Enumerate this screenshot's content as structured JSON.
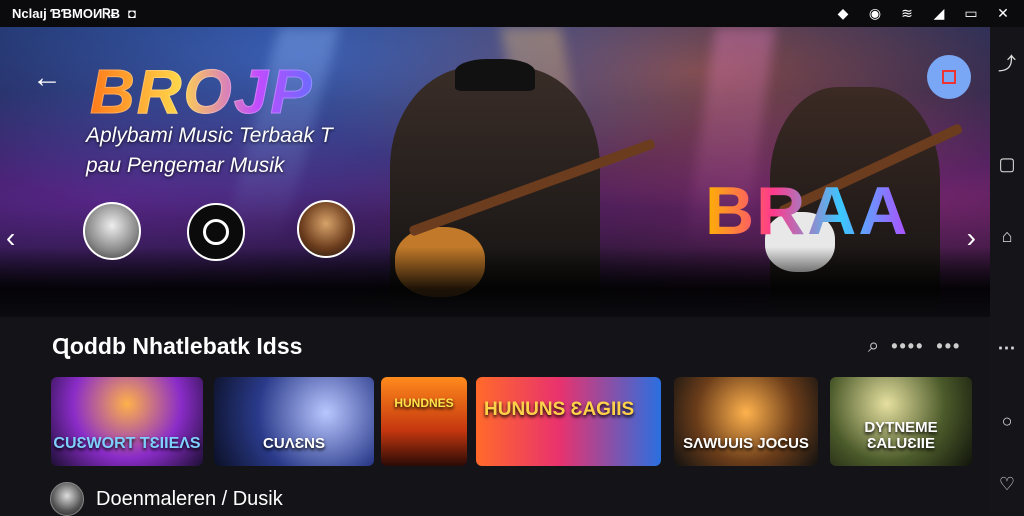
{
  "status_bar": {
    "app_name": "Nclaıj ƁƁMOИᏒɃ",
    "icons": [
      "notification-icon",
      "vpn-icon",
      "wifi-icon",
      "signal-icon",
      "cast-icon",
      "close-icon"
    ]
  },
  "hero": {
    "title": "BROJP",
    "subtitle_line1": "Aplybami Music Terbaak T",
    "subtitle_line2": "pau Pengemar Musik",
    "neon_text": "BRAA"
  },
  "section": {
    "title": "Ɋoddb Nhatlebatk Idss"
  },
  "thumbnails": [
    {
      "label": "CUƐWORT TƐIIEΛS"
    },
    {
      "label": "CUΛƐNS"
    },
    {
      "label": "HUNDNES"
    },
    {
      "label": "HUNUNS ƐAGIIS"
    },
    {
      "label": "SΛWUUIS JOCUS"
    },
    {
      "label": "DYTNEME ƐALUƐIIE"
    }
  ],
  "footer": {
    "text": "Doenmaleren / Dusik"
  }
}
